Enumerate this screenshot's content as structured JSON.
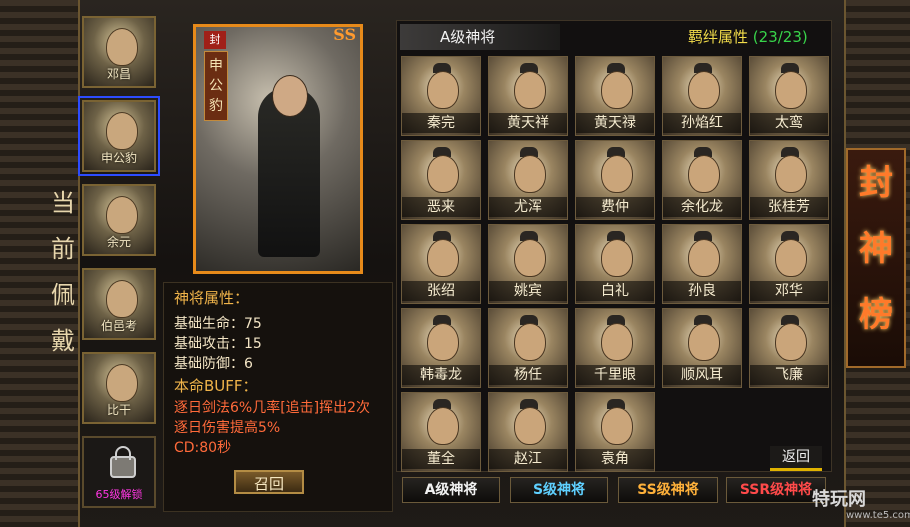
{
  "left_title": [
    "当",
    "前",
    "佩",
    "戴"
  ],
  "equipped": [
    {
      "name": "邓昌",
      "selected": false
    },
    {
      "name": "申公豹",
      "selected": true
    },
    {
      "name": "余元",
      "selected": false
    },
    {
      "name": "伯邑考",
      "selected": false
    },
    {
      "name": "比干",
      "selected": false
    }
  ],
  "locked_slot": {
    "label": "65级解锁"
  },
  "card": {
    "seal": "封",
    "grade": "SS",
    "name_chars": [
      "申",
      "公",
      "豹"
    ]
  },
  "info": {
    "attr_title": "神将属性：",
    "hp": "基础生命：75",
    "atk": "基础攻击：15",
    "def": "基础防御：6",
    "buff_title": "本命BUFF：",
    "buff1": "逐日剑法6%几率[追击]挥出2次",
    "buff2": "逐日伤害提高5%",
    "cd": "CD:80秒"
  },
  "recall_label": "召回",
  "grid": {
    "tab_label": "A级神将",
    "bond_label": "羁绊属性",
    "bond_count": "(23/23)",
    "back_label": "返回",
    "cells": [
      "秦完",
      "黄天祥",
      "黄天禄",
      "孙焰红",
      "太鸾",
      "恶来",
      "尤浑",
      "费仲",
      "余化龙",
      "张桂芳",
      "张绍",
      "姚宾",
      "白礼",
      "孙良",
      "邓华",
      "韩毒龙",
      "杨任",
      "千里眼",
      "顺风耳",
      "飞廉",
      "董全",
      "赵江",
      "袁角"
    ]
  },
  "bottom_tabs": [
    {
      "label": "A级神将",
      "color": "#f2f2f2"
    },
    {
      "label": "S级神将",
      "color": "#5fd0ff"
    },
    {
      "label": "SS级神将",
      "color": "#ffb13a"
    },
    {
      "label": "SSR级神将",
      "color": "#ff4a4a"
    }
  ],
  "banner": [
    "封",
    "神",
    "榜"
  ],
  "watermark": {
    "main": "特玩网",
    "sub": "www.te5.com"
  }
}
